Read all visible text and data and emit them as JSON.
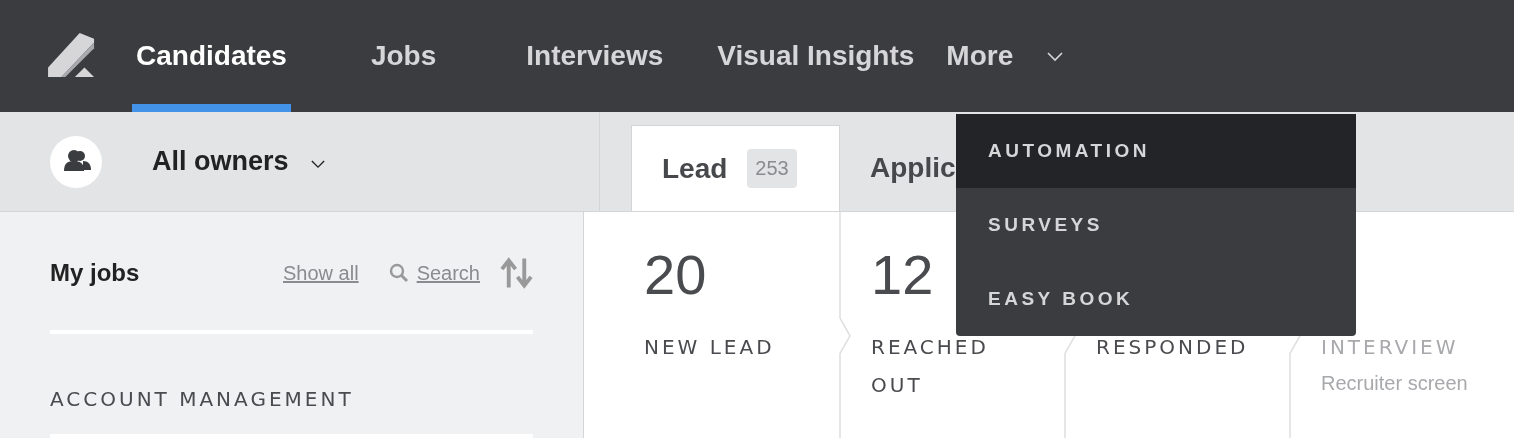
{
  "nav": {
    "items": [
      {
        "label": "Candidates",
        "selected": true
      },
      {
        "label": "Jobs",
        "selected": false
      },
      {
        "label": "Interviews",
        "selected": false
      },
      {
        "label": "Visual Insights",
        "selected": false
      },
      {
        "label": "More",
        "selected": false
      }
    ]
  },
  "owner_filter": {
    "value": "All owners"
  },
  "pipeline_tabs": [
    {
      "label": "Lead",
      "count": "253",
      "selected": true
    },
    {
      "label": "Applic",
      "selected": false
    }
  ],
  "sidebar": {
    "title": "My jobs",
    "show_all": "Show all",
    "search": "Search",
    "groups": [
      "ACCOUNT MANAGEMENT"
    ]
  },
  "stages": [
    {
      "count": "20",
      "name": "NEW LEAD",
      "dimmed": false
    },
    {
      "count": "12",
      "name": "REACHED OUT",
      "dimmed": false
    },
    {
      "name": "RESPONDED",
      "dimmed": false
    },
    {
      "name": "INTERVIEW",
      "subtitle": "Recruiter screen",
      "dimmed": true
    }
  ],
  "more_menu": [
    {
      "label": "AUTOMATION",
      "selected": true
    },
    {
      "label": "SURVEYS",
      "selected": false
    },
    {
      "label": "EASY BOOK",
      "selected": false
    }
  ]
}
